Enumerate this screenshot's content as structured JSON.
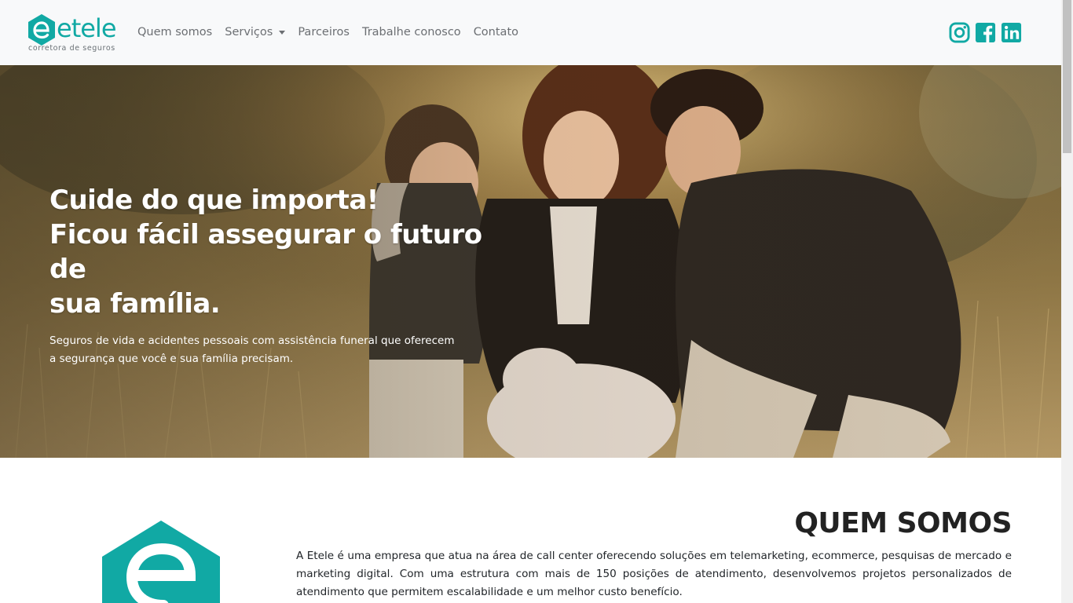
{
  "navbar": {
    "brand_word": "etele",
    "brand_tagline": "corretora de seguros",
    "links": [
      {
        "label": "Quem somos"
      },
      {
        "label": "Serviços"
      },
      {
        "label": "Parceiros"
      },
      {
        "label": "Trabalhe conosco"
      },
      {
        "label": "Contato"
      }
    ],
    "socials": [
      "instagram-icon",
      "facebook-icon",
      "linkedin-icon"
    ]
  },
  "hero": {
    "title_line1": "Cuide do que importa!",
    "title_line2": "Ficou fácil assegurar o futuro de",
    "title_line3": "sua família.",
    "subtitle": "Seguros de vida e acidentes pessoais com assistência funeral que oferecem a segurança que você e sua família precisam."
  },
  "about": {
    "heading": "QUEM SOMOS",
    "text": "A Etele é uma empresa que atua na área de call center oferecendo soluções em telemarketing, ecommerce, pesquisas de mercado e marketing digital. Com uma estrutura com mais de 150 posições de atendimento, desenvolvemos projetos personalizados de atendimento que permitem escalabilidade e um melhor custo benefício."
  },
  "colors": {
    "brand": "#11a9a4",
    "navbar_bg": "#f8f9fa",
    "nav_text": "#6c6f73"
  }
}
